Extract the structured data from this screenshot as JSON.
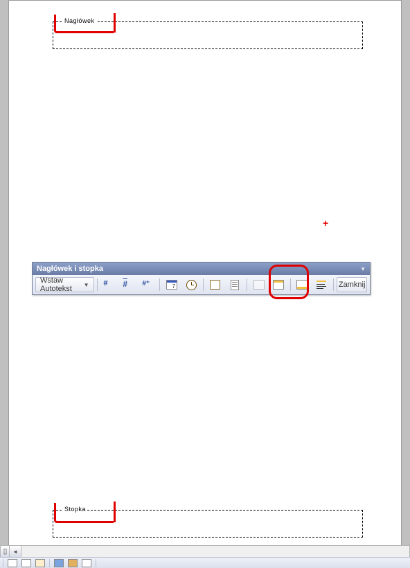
{
  "document": {
    "header_label": "Nagłówek",
    "footer_label": "Stopka"
  },
  "toolbar": {
    "title": "Nagłówek i stopka",
    "autotext_button": "Wstaw Autotekst",
    "close_button": "Zamknij",
    "icons": [
      "insert-page-number-icon",
      "insert-pages-count-icon",
      "format-page-number-icon",
      "insert-date-icon",
      "insert-time-icon",
      "page-setup-icon",
      "show-document-text-icon",
      "link-to-previous-icon",
      "same-as-previous-icon",
      "switch-header-footer-icon",
      "show-previous-icon",
      "show-next-icon"
    ]
  },
  "annotations": {
    "cursor_marker": "+"
  }
}
